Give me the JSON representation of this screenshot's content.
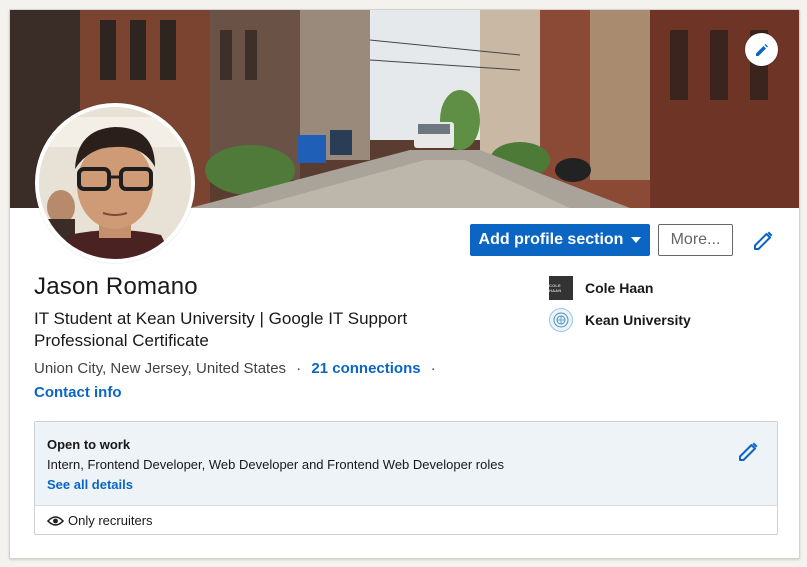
{
  "profile": {
    "name": "Jason Romano",
    "headline": "IT Student at Kean University | Google IT Support Professional Certificate",
    "location": "Union City, New Jersey, United States",
    "connections": "21 connections",
    "contact_info": "Contact info"
  },
  "actions": {
    "add_section": "Add profile section",
    "more": "More..."
  },
  "organizations": [
    {
      "name": "Cole Haan",
      "logo_text": "COLE HAAN"
    },
    {
      "name": "Kean University"
    }
  ],
  "open_to_work": {
    "title": "Open to work",
    "roles": "Intern, Frontend Developer, Web Developer and Frontend Web Developer roles",
    "details_link": "See all details",
    "visibility": "Only recruiters"
  },
  "colors": {
    "accent": "#0a66c2",
    "open_to_work_bg": "#eef3f8"
  },
  "icons": {
    "banner_edit": "pencil-icon",
    "profile_edit": "pencil-icon",
    "open_to_work_edit": "pencil-icon",
    "visibility": "eye-icon"
  }
}
